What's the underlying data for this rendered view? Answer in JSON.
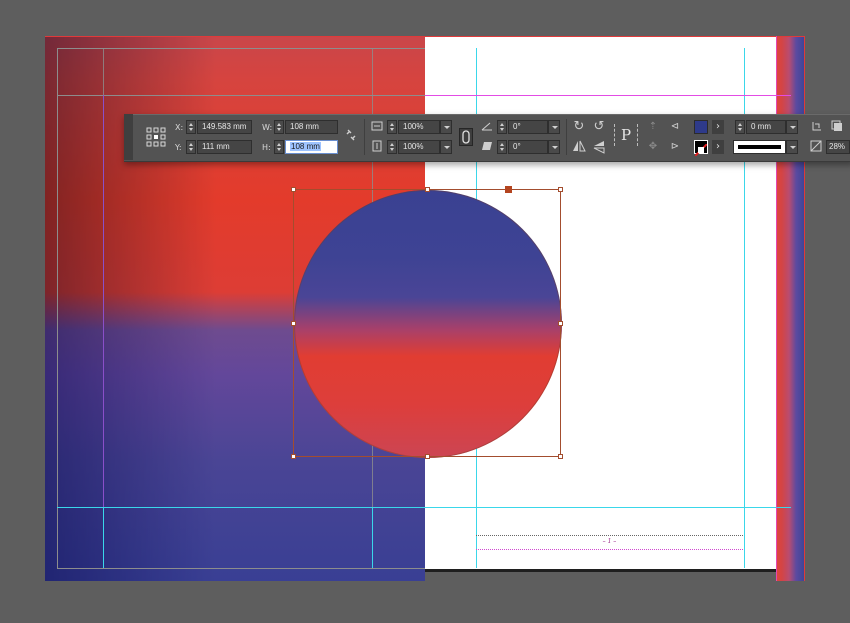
{
  "control_panel": {
    "x_label": "X:",
    "x_value": "149.583 mm",
    "y_label": "Y:",
    "y_value": "111 mm",
    "w_label": "W:",
    "w_value": "108 mm",
    "h_label": "H:",
    "h_value": "108 mm",
    "scale_x_value": "100%",
    "scale_y_value": "100%",
    "rotate_value": "0°",
    "shear_value": "0°",
    "type_on_path_glyph": "P",
    "stroke_weight_value": "0 mm",
    "opacity_value": "28%",
    "fill_color": "#2e3a8a",
    "stroke_color": "#000000"
  },
  "page": {
    "page_number_marker": "– 1 –"
  },
  "colors": {
    "selection": "#a34d2e",
    "guide_cyan": "#3ad7ea",
    "guide_magenta": "#e34ce5",
    "accent_red": "#e03b2c",
    "accent_blue": "#393f94"
  }
}
